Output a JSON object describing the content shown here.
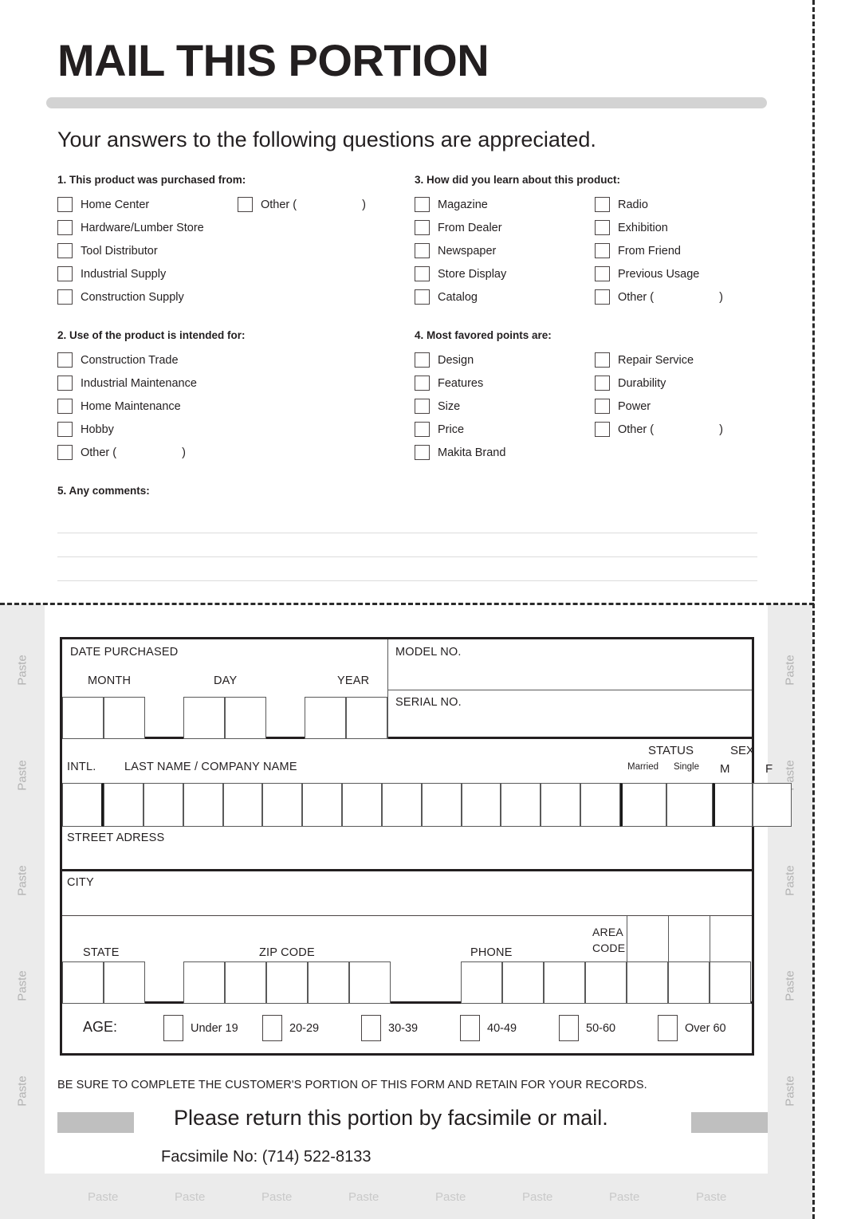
{
  "header": {
    "title": "MAIL THIS PORTION",
    "subtitle": "Your answers to the following questions are appreciated."
  },
  "questions": [
    {
      "id": "q1",
      "heading": "1. This product was purchased from:",
      "col1": [
        "Home Center",
        "Hardware/Lumber Store",
        "Tool Distributor",
        "Industrial Supply",
        "Construction Supply"
      ],
      "col2": [
        "Other ("
      ],
      "col2_close": [
        ")"
      ]
    },
    {
      "id": "q3",
      "heading": "3. How did you learn about this product:",
      "col1": [
        "Magazine",
        "From Dealer",
        "Newspaper",
        "Store Display",
        "Catalog"
      ],
      "col2": [
        "Radio",
        "Exhibition",
        "From Friend",
        "Previous Usage",
        "Other ("
      ],
      "col2_close": [
        ")"
      ]
    },
    {
      "id": "q2",
      "heading": "2. Use of the product is intended for:",
      "col1": [
        "Construction Trade",
        "Industrial Maintenance",
        "Home Maintenance",
        "Hobby",
        "Other ("
      ],
      "col1_close": ")",
      "col2": [],
      "col2_close": []
    },
    {
      "id": "q4",
      "heading": "4. Most favored points are:",
      "col1": [
        "Design",
        "Features",
        "Size",
        "Price",
        "Makita Brand"
      ],
      "col2": [
        "Repair Service",
        "Durability",
        "Power",
        "Other ("
      ],
      "col2_close": [
        ")"
      ]
    }
  ],
  "comments": {
    "heading": "5. Any comments:",
    "line_count": 4
  },
  "card": {
    "date_purchased_label": "DATE PURCHASED",
    "month_label": "MONTH",
    "day_label": "DAY",
    "year_label": "YEAR",
    "model_no_label": "MODEL NO.",
    "serial_no_label": "SERIAL NO.",
    "intl_label": "INTL.",
    "name_label": "LAST NAME / COMPANY NAME",
    "status_label": "STATUS",
    "married_label": "Married",
    "single_label": "Single",
    "sex_label": "SEX",
    "male_label": "M",
    "female_label": "F",
    "street_label": "STREET ADRESS",
    "city_label": "CITY",
    "state_label": "STATE",
    "zip_label": "ZIP CODE",
    "phone_label": "PHONE",
    "area_label": "AREA",
    "code_label": "CODE",
    "age_label": "AGE:",
    "age_options": [
      "Under 19",
      "20-29",
      "30-39",
      "40-49",
      "50-60",
      "Over 60"
    ]
  },
  "footer": {
    "notice": "BE SURE TO COMPLETE THE CUSTOMER'S PORTION OF THIS FORM AND RETAIN FOR YOUR RECORDS.",
    "return_text": "Please return this portion by facsimile or mail.",
    "fax_text": "Facsimile No: (714) 522-8133"
  },
  "paste": {
    "label": "Paste",
    "left_count": 5,
    "right_count": 5,
    "bottom_count": 8
  },
  "colors": {
    "ink": "#231f20",
    "rule": "#d3d3d3",
    "paste_bg": "#ebebeb",
    "chip": "#bfbfbf"
  }
}
